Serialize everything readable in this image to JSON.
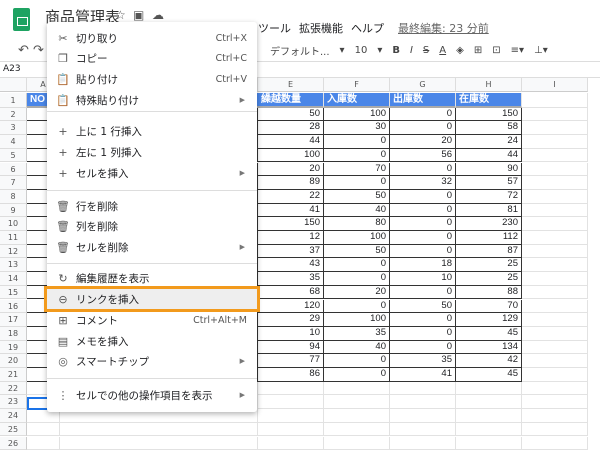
{
  "app": {
    "title": "商品管理表",
    "menus": [
      "ツール",
      "拡張機能",
      "ヘルプ"
    ],
    "last_edit": "最終編集: 23 分前"
  },
  "toolbar": {
    "font": "デフォルト...",
    "size": "10",
    "bold": "B",
    "italic": "I",
    "strike": "S",
    "color": "A"
  },
  "namebox": "A23",
  "columns": [
    "A",
    "E",
    "F",
    "G",
    "H",
    "I"
  ],
  "header": {
    "a": "NO",
    "e": "繰越数量",
    "f": "入庫数",
    "g": "出庫数",
    "h": "在庫数"
  },
  "rows": {
    "e": [
      50,
      28,
      44,
      100,
      20,
      89,
      22,
      41,
      150,
      12,
      37,
      43,
      35,
      68,
      120,
      29,
      10,
      94,
      77,
      86
    ],
    "f": [
      100,
      30,
      0,
      0,
      70,
      0,
      50,
      40,
      80,
      100,
      50,
      0,
      0,
      20,
      0,
      100,
      35,
      40,
      0,
      0
    ],
    "g": [
      0,
      0,
      20,
      56,
      0,
      32,
      0,
      0,
      0,
      0,
      0,
      18,
      10,
      0,
      50,
      0,
      0,
      0,
      35,
      41
    ],
    "h": [
      150,
      58,
      24,
      44,
      90,
      57,
      72,
      81,
      230,
      112,
      87,
      25,
      25,
      88,
      70,
      129,
      45,
      134,
      42,
      45
    ]
  },
  "menu": [
    {
      "label": "切り取り",
      "shortcut": "Ctrl+X",
      "icon": "scissors-icon",
      "g": "✂"
    },
    {
      "label": "コピー",
      "shortcut": "Ctrl+C",
      "icon": "copy-icon",
      "g": "❐"
    },
    {
      "label": "貼り付け",
      "shortcut": "Ctrl+V",
      "icon": "clipboard-icon",
      "g": "📋"
    },
    {
      "label": "特殊貼り付け",
      "arrow": "▶",
      "icon": "clipboard-icon",
      "g": "📋"
    },
    {
      "label": "上に 1 行挿入",
      "icon": "plus-icon",
      "g": "+"
    },
    {
      "label": "左に 1 列挿入",
      "icon": "plus-icon",
      "g": "+"
    },
    {
      "label": "セルを挿入",
      "arrow": "▶",
      "icon": "plus-icon",
      "g": "+"
    },
    {
      "label": "行を削除",
      "icon": "trash-icon",
      "g": "🗑"
    },
    {
      "label": "列を削除",
      "icon": "trash-icon",
      "g": "🗑"
    },
    {
      "label": "セルを削除",
      "arrow": "▶",
      "icon": "trash-icon",
      "g": "🗑"
    },
    {
      "label": "編集履歴を表示",
      "icon": "history-icon",
      "g": "↻"
    },
    {
      "label": "リンクを挿入",
      "icon": "link-icon",
      "g": "⊖"
    },
    {
      "label": "コメント",
      "shortcut": "Ctrl+Alt+M",
      "icon": "comment-icon",
      "g": "⊞"
    },
    {
      "label": "メモを挿入",
      "icon": "note-icon",
      "g": "▤"
    },
    {
      "label": "スマートチップ",
      "arrow": "▶",
      "icon": "smart-chip-icon",
      "g": "◎"
    },
    {
      "label": "セルでの他の操作項目を表示",
      "arrow": "▶",
      "icon": "more-vert-icon",
      "g": "⋮"
    }
  ]
}
